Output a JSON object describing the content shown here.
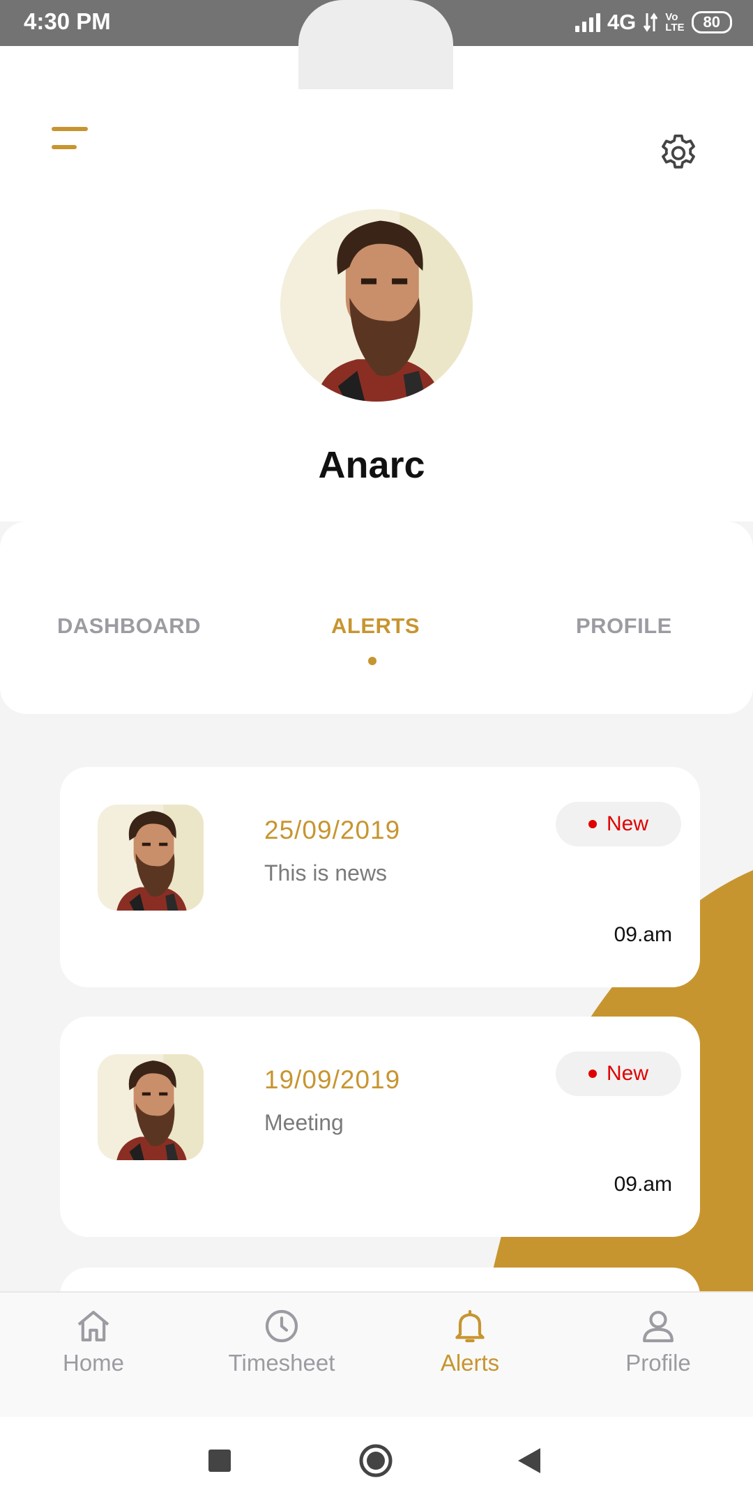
{
  "status_bar": {
    "time": "4:30 PM",
    "network": "4G",
    "volte_top": "Vo",
    "volte_bottom": "LTE",
    "battery": "80"
  },
  "header": {
    "menu_icon": "menu-icon",
    "settings_icon": "gear-icon",
    "user_name": "Anarc"
  },
  "tabs": [
    {
      "label": "DASHBOARD",
      "active": false
    },
    {
      "label": "ALERTS",
      "active": true
    },
    {
      "label": "PROFILE",
      "active": false
    }
  ],
  "alerts": [
    {
      "date": "25/09/2019",
      "message": "This is news",
      "badge": "New",
      "time": "09.am"
    },
    {
      "date": "19/09/2019",
      "message": "Meeting",
      "badge": "New",
      "time": "09.am"
    }
  ],
  "bottom_nav": [
    {
      "label": "Home",
      "icon": "home-icon",
      "active": false
    },
    {
      "label": "Timesheet",
      "icon": "clock-icon",
      "active": false
    },
    {
      "label": "Alerts",
      "icon": "bell-icon",
      "active": true
    },
    {
      "label": "Profile",
      "icon": "user-icon",
      "active": false
    }
  ],
  "colors": {
    "accent": "#c79530",
    "badge_red": "#e00000",
    "inactive": "#9b9ba2"
  }
}
